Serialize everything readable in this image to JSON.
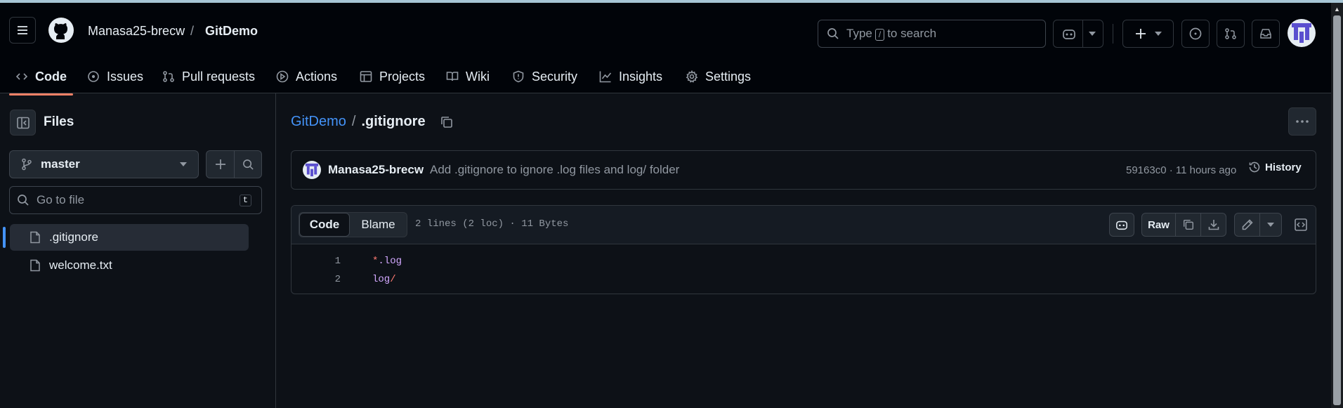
{
  "repo": {
    "owner": "Manasa25-brecw",
    "separator": "/",
    "name": "GitDemo"
  },
  "search": {
    "prefix": "Type",
    "key": "/",
    "suffix": "to search"
  },
  "nav": [
    {
      "label": "Code",
      "icon": "code-icon"
    },
    {
      "label": "Issues",
      "icon": "issue-icon"
    },
    {
      "label": "Pull requests",
      "icon": "pull-request-icon"
    },
    {
      "label": "Actions",
      "icon": "actions-play-icon"
    },
    {
      "label": "Projects",
      "icon": "table-icon"
    },
    {
      "label": "Wiki",
      "icon": "book-icon"
    },
    {
      "label": "Security",
      "icon": "shield-icon"
    },
    {
      "label": "Insights",
      "icon": "graph-icon"
    },
    {
      "label": "Settings",
      "icon": "gear-icon"
    }
  ],
  "sidebar": {
    "title": "Files",
    "branch": "master",
    "filter_placeholder": "Go to file",
    "filter_key": "t",
    "files": [
      {
        "name": ".gitignore",
        "selected": true
      },
      {
        "name": "welcome.txt",
        "selected": false
      }
    ]
  },
  "breadcrumb": {
    "repo": "GitDemo",
    "sep": "/",
    "file": ".gitignore"
  },
  "commit": {
    "author": "Manasa25-brecw",
    "message": "Add .gitignore to ignore .log files and log/ folder",
    "meta": "59163c0 · 11 hours ago",
    "history_label": "History"
  },
  "fileview": {
    "tabs": [
      "Code",
      "Blame"
    ],
    "info": "2 lines (2 loc) · 11 Bytes",
    "raw_label": "Raw"
  },
  "code_lines": [
    {
      "num": "1",
      "text": "*.log"
    },
    {
      "num": "2",
      "text": "log/"
    }
  ],
  "colors": {
    "accent": "#f78166",
    "link": "#4493f8",
    "bg": "#0d1117",
    "header_bg": "#010409"
  }
}
